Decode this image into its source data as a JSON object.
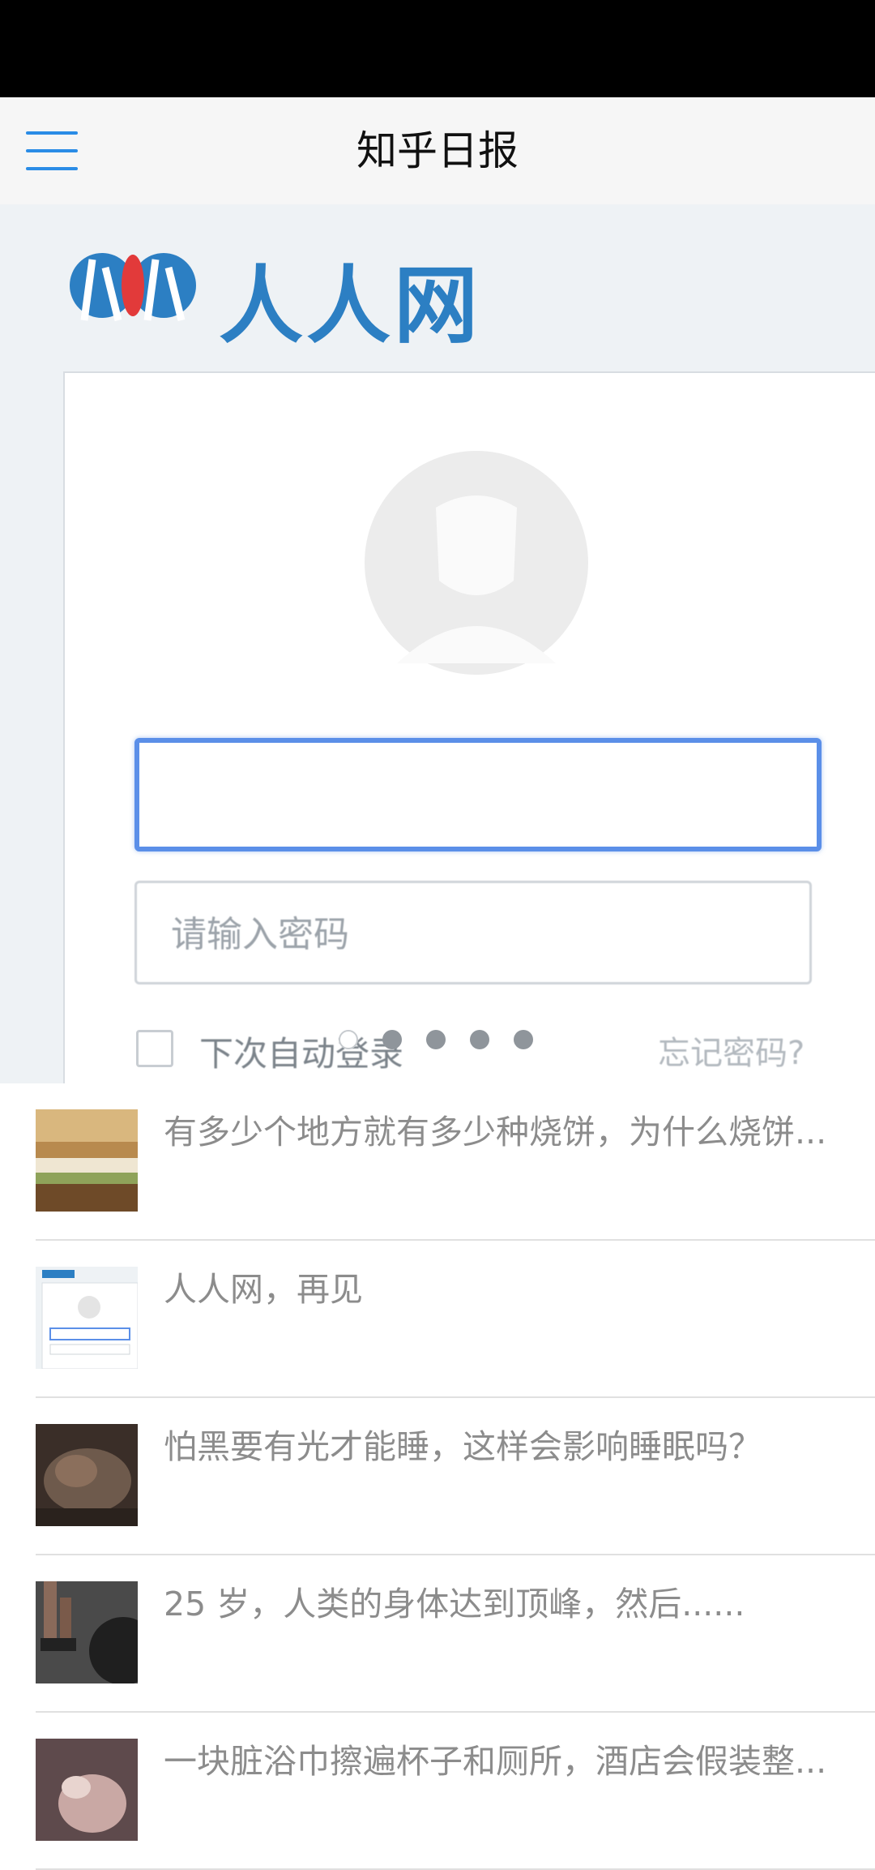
{
  "toolbar": {
    "title": "知乎日报",
    "menu_icon": "hamburger-menu-icon",
    "accent": "#2a8ce6"
  },
  "banner": {
    "logo_text": "人人网",
    "password_placeholder": "请输入密码",
    "remember_label": "下次自动登录",
    "forgot_link": "忘记密码?",
    "pager": {
      "count": 5,
      "active_index": 0
    }
  },
  "news": [
    {
      "title": "有多少个地方就有多少种烧饼，为什么烧饼..."
    },
    {
      "title": "人人网，再见"
    },
    {
      "title": "怕黑要有光才能睡，这样会影响睡眠吗？"
    },
    {
      "title": "25 岁，人类的身体达到顶峰，然后......"
    },
    {
      "title": "一块脏浴巾擦遍杯子和厕所，酒店会假装整..."
    }
  ]
}
